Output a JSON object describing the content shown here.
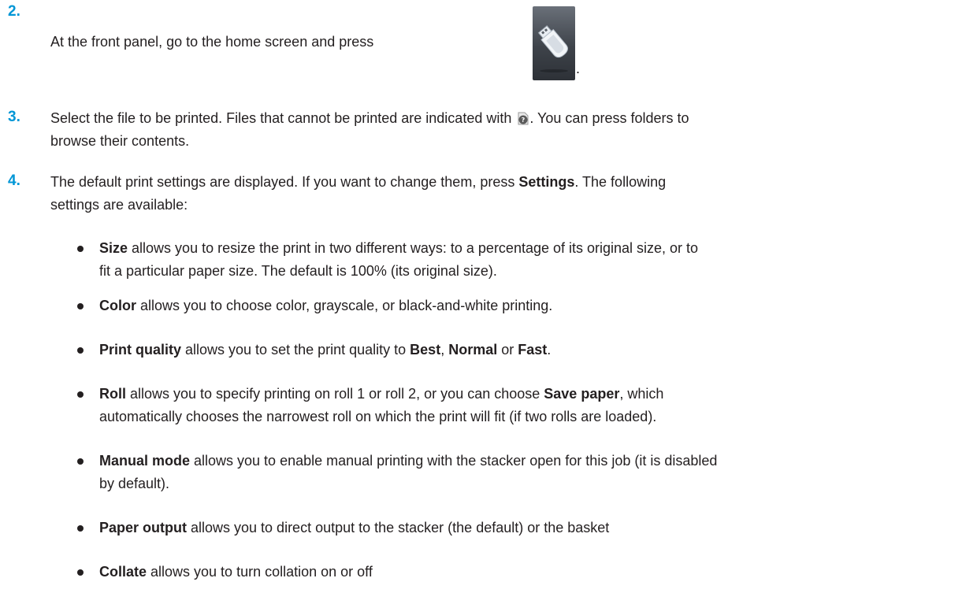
{
  "steps": [
    {
      "number": "2.",
      "text": "At the front panel, go to the home screen and press",
      "after_icon": "."
    },
    {
      "number": "3.",
      "text_before_icon": "Select the file to be printed. Files that cannot be printed are indicated with",
      "text_after_icon": ". You can press folders to",
      "line2": "browse their contents."
    },
    {
      "number": "4.",
      "text_a": "The default print settings are displayed. If you want to change them, press ",
      "bold_settings": "Settings",
      "text_b": ". The following",
      "line2": "settings are available:"
    }
  ],
  "icons": {
    "usb": "usb-flash-drive-icon",
    "unprintable": "question-file-icon"
  },
  "bullets": [
    {
      "bold": "Size",
      "line1": " allows you to resize the print in two different ways: to a percentage of its original size, or to",
      "line2": "fit a particular paper size. The default is 100% (its original size)."
    },
    {
      "bold": "Color",
      "line1": " allows you to choose color, grayscale, or black-and-white printing."
    },
    {
      "bold": "Print quality",
      "line1": " allows you to set the print quality to ",
      "opt1": "Best",
      "sep1": ", ",
      "opt2": "Normal",
      "sep2": " or ",
      "opt3": "Fast",
      "end": "."
    },
    {
      "bold": "Roll",
      "line1": " allows you to specify printing on roll 1 or roll 2, or you can choose ",
      "bold2": "Save paper",
      "line1b": ", which",
      "line2": "automatically chooses the narrowest roll on which the print will fit (if two rolls are loaded)."
    },
    {
      "bold": "Manual mode",
      "line1": " allows you to enable manual printing with the stacker open for this job (it is disabled",
      "line2": "by default)."
    },
    {
      "bold": "Paper output",
      "line1": " allows you to direct output to the stacker (the default) or the basket"
    },
    {
      "bold": "Collate",
      "line1": " allows you to turn collation on or off"
    }
  ]
}
